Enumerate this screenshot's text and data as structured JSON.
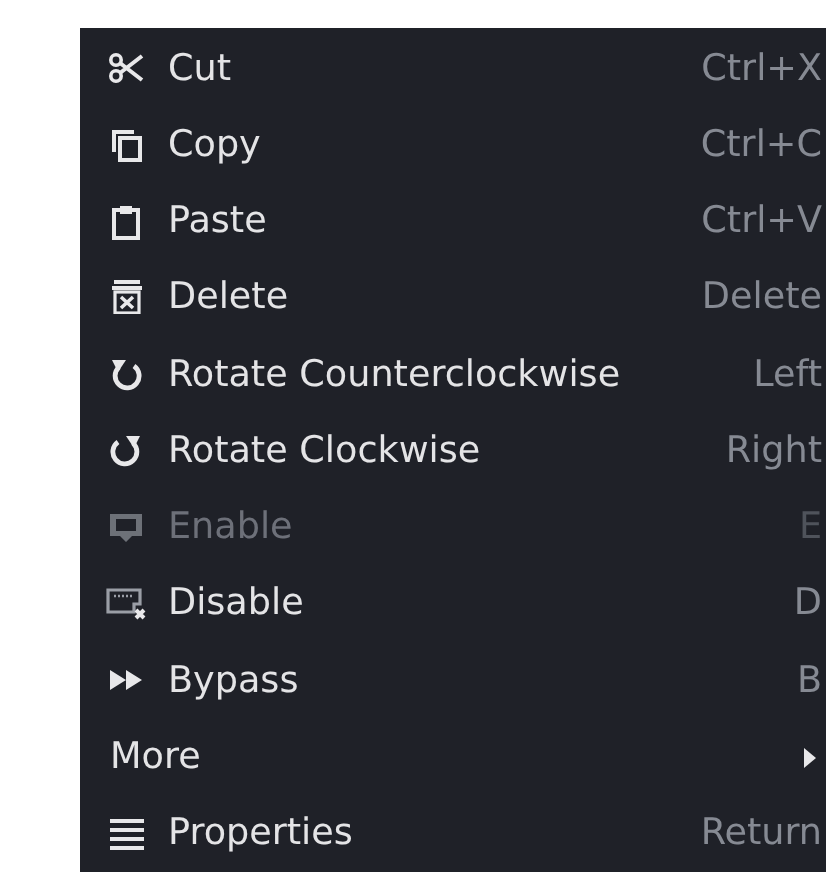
{
  "menu": {
    "items": [
      {
        "kind": "action",
        "label": "Cut",
        "shortcut": "Ctrl+X",
        "disabled": false
      },
      {
        "kind": "action",
        "label": "Copy",
        "shortcut": "Ctrl+C",
        "disabled": false
      },
      {
        "kind": "action",
        "label": "Paste",
        "shortcut": "Ctrl+V",
        "disabled": false
      },
      {
        "kind": "action",
        "label": "Delete",
        "shortcut": "Delete",
        "disabled": false
      },
      {
        "kind": "action",
        "label": "Rotate Counterclockwise",
        "shortcut": "Left",
        "disabled": false
      },
      {
        "kind": "action",
        "label": "Rotate Clockwise",
        "shortcut": "Right",
        "disabled": false
      },
      {
        "kind": "action",
        "label": "Enable",
        "shortcut": "E",
        "disabled": true
      },
      {
        "kind": "action",
        "label": "Disable",
        "shortcut": "D",
        "disabled": false
      },
      {
        "kind": "action",
        "label": "Bypass",
        "shortcut": "B",
        "disabled": false
      },
      {
        "kind": "submenu",
        "label": "More",
        "disabled": false
      },
      {
        "kind": "action",
        "label": "Properties",
        "shortcut": "Return",
        "disabled": false
      }
    ]
  }
}
